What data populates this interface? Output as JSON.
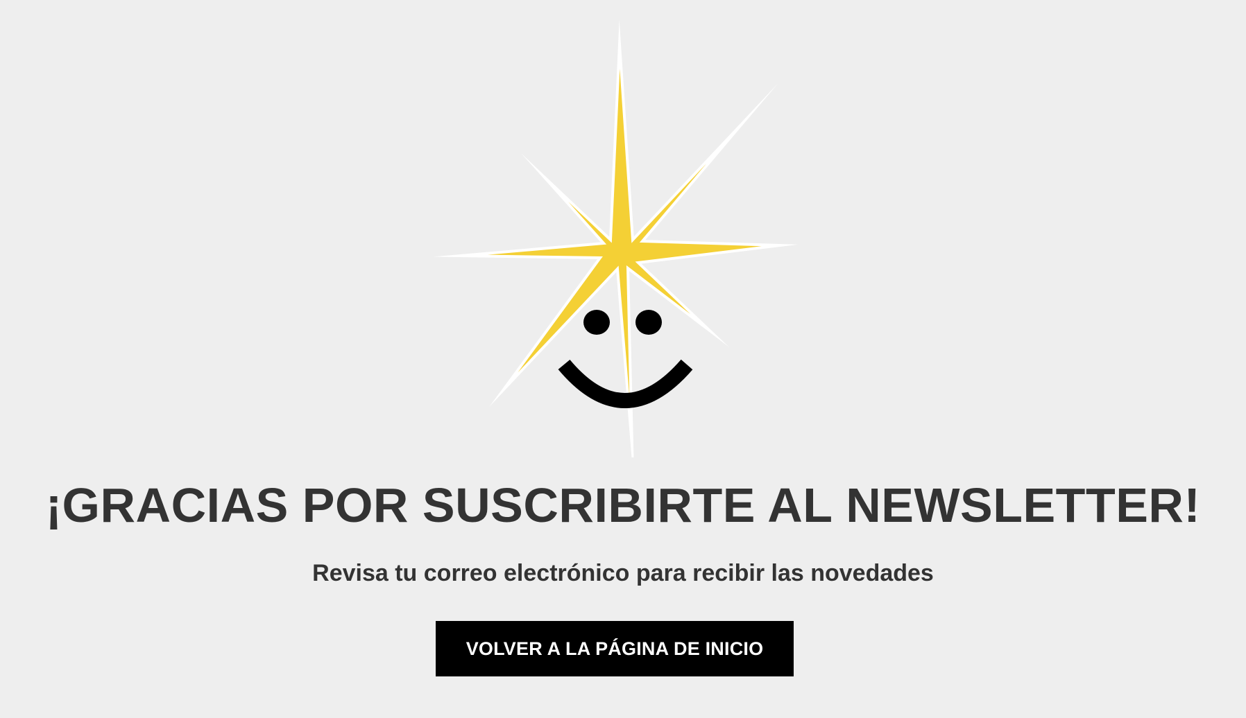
{
  "illustration": {
    "name": "star-smiley-icon",
    "star_color": "#f4d035",
    "outline_color": "#ffffff",
    "face_color": "#000000"
  },
  "content": {
    "headline": "¡GRACIAS POR SUSCRIBIRTE AL NEWSLETTER!",
    "subtitle": "Revisa tu correo electrónico para recibir las novedades"
  },
  "cta": {
    "label": "VOLVER A LA PÁGINA DE INICIO"
  },
  "colors": {
    "background": "#eeeeee",
    "text": "#333333",
    "button_bg": "#000000",
    "button_text": "#ffffff"
  }
}
